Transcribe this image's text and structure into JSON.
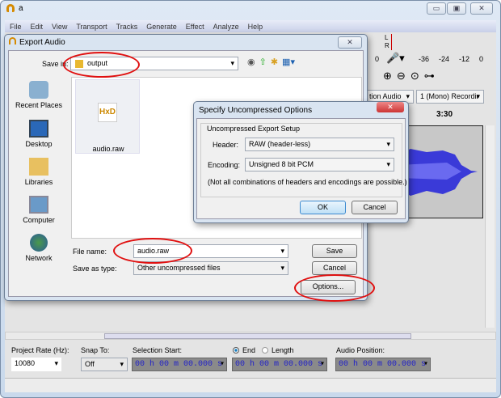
{
  "window": {
    "title": "a",
    "controls": [
      "▭",
      "▣",
      "✕"
    ]
  },
  "menu": [
    "File",
    "Edit",
    "View",
    "Transport",
    "Tracks",
    "Generate",
    "Effect",
    "Analyze",
    "Help"
  ],
  "meter": {
    "l": "L",
    "r": "R",
    "left_zero": "0",
    "scale": [
      "-36",
      "-24",
      "-12",
      "0"
    ]
  },
  "track_toolbar": {
    "host_combo": "tion Audio",
    "channels_combo": "1 (Mono) Recordir"
  },
  "timeline": {
    "label": "3:30"
  },
  "export_dialog": {
    "title": "Export Audio",
    "save_in_label": "Save in:",
    "save_in_value": "output",
    "places": [
      "Recent Places",
      "Desktop",
      "Libraries",
      "Computer",
      "Network"
    ],
    "files": [
      {
        "name": "audio.raw"
      }
    ],
    "file_name_label": "File name:",
    "file_name_value": "audio.raw",
    "save_as_type_label": "Save as type:",
    "save_as_type_value": "Other uncompressed files",
    "save": "Save",
    "cancel": "Cancel",
    "options": "Options..."
  },
  "options_dialog": {
    "title": "Specify Uncompressed Options",
    "group": "Uncompressed Export Setup",
    "header_label": "Header:",
    "header_value": "RAW (header-less)",
    "encoding_label": "Encoding:",
    "encoding_value": "Unsigned 8 bit PCM",
    "note": "(Not all combinations of headers and encodings are possible.)",
    "ok": "OK",
    "cancel": "Cancel"
  },
  "selection_toolbar": {
    "rate_label": "Project Rate (Hz):",
    "rate_value": "10080",
    "snap_label": "Snap To:",
    "snap_value": "Off",
    "sel_start_label": "Selection Start:",
    "end_label": "End",
    "length_label": "Length",
    "end_selected": true,
    "audio_pos_label": "Audio Position:",
    "sel_start": "00 h 00 m 00.000 s",
    "sel_end": "00 h 00 m 00.000 s",
    "audio_pos": "00 h 00 m 00.000 s"
  },
  "colors": {
    "waveform": "#3a3ad8",
    "highlight": "#e01010",
    "timecode": "#2020c8"
  }
}
